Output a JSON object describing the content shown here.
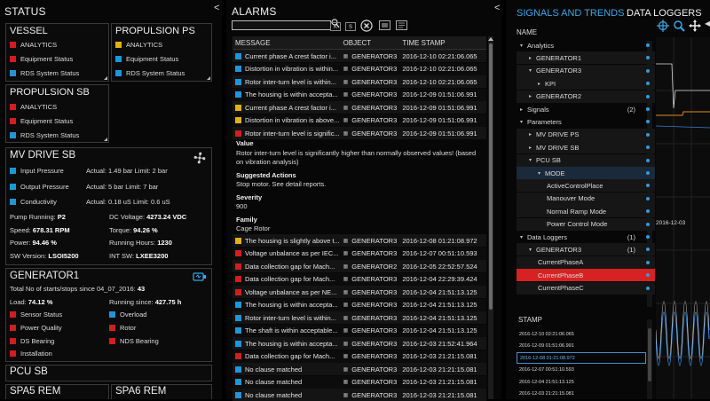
{
  "status": {
    "header": "STATUS",
    "collapse": "<",
    "vessel": {
      "title": "VESSEL",
      "items": [
        "ANALYTICS",
        "Equipment Status",
        "RDS System Status"
      ]
    },
    "propulsion_ps": {
      "title": "PROPULSION PS",
      "items": [
        "ANALYTICS",
        "Equipment Status",
        "RDS System Status"
      ]
    },
    "propulsion_sb": {
      "title": "PROPULSION SB",
      "items": [
        "ANALYTICS",
        "Equipment Status",
        "RDS System Status"
      ]
    },
    "mv_drive_sb": {
      "title": "MV DRIVE SB",
      "metrics": [
        {
          "label": "Input Pressure",
          "value": "Actual: 1.49 bar Limit: 2 bar"
        },
        {
          "label": "Output Pressure",
          "value": "Actual: 5 bar Limit: 7 bar"
        },
        {
          "label": "Conductivity",
          "value": "Actual: 0.18 uS Limit: 0.6 uS"
        }
      ],
      "kv": [
        {
          "k": "Pump Running:",
          "v": "P2"
        },
        {
          "k": "DC Voltage:",
          "v": "4273.24 VDC"
        },
        {
          "k": "Speed:",
          "v": "678.31 RPM"
        },
        {
          "k": "Torque:",
          "v": "94.26 %"
        },
        {
          "k": "Power:",
          "v": "94.46 %"
        },
        {
          "k": "Running Hours:",
          "v": "1230"
        },
        {
          "k": "SW Version:",
          "v": "LSOI5200"
        },
        {
          "k": "INT SW:",
          "v": "LXEE3200"
        }
      ]
    },
    "generator1": {
      "title": "GENERATOR1",
      "starts_label": "Total No of starts/stops since 04_07_2016:",
      "starts_value": "43",
      "load_label": "Load:",
      "load_value": "74.12 %",
      "running_label": "Running since:",
      "running_value": "427.75 h",
      "items_left": [
        "Sensor Status",
        "Power Quality",
        "DS Bearing",
        "Installation"
      ],
      "items_right": [
        "Overload",
        "Rotor",
        "NDS Bearing"
      ]
    },
    "pcu_sb": {
      "title": "PCU SB"
    },
    "spa5": {
      "title": "SPA5 REM"
    },
    "spa6": {
      "title": "SPA6 REM"
    }
  },
  "alarms": {
    "header": "ALARMS",
    "collapse": "<",
    "search_value": "",
    "toolbar": [
      "K",
      "S",
      "",
      "",
      ""
    ],
    "columns": [
      "MESSAGE",
      "OBJECT",
      "TIME STAMP"
    ],
    "rows_top": [
      {
        "color": "blue",
        "msg": "Current phase A crest factor i...",
        "obj": "GENERATOR3",
        "ts": "2016-12-10 02:21:06.065"
      },
      {
        "color": "blue",
        "msg": "Distortion in vibration is within...",
        "obj": "GENERATOR3",
        "ts": "2016-12-10 02:21:06.065"
      },
      {
        "color": "blue",
        "msg": "Rotor inter-turn level is within...",
        "obj": "GENERATOR3",
        "ts": "2016-12-10 02:21:06.065"
      },
      {
        "color": "blue",
        "msg": "The housing is within accepta...",
        "obj": "GENERATOR3",
        "ts": "2016-12-09 01:51:06.991"
      },
      {
        "color": "yel",
        "msg": "Current phase A crest factor i...",
        "obj": "GENERATOR3",
        "ts": "2016-12-09 01:51:06.991"
      },
      {
        "color": "yel",
        "msg": "Distortion in vibration is above...",
        "obj": "GENERATOR3",
        "ts": "2016-12-09 01:51:06.991"
      },
      {
        "color": "red",
        "msg": "Rotor inter-turn level is signific...",
        "obj": "GENERATOR3",
        "ts": "2016-12-09 01:51:06.991"
      }
    ],
    "detail": {
      "value_label": "Value",
      "value_text": "Rotor inter-turn level is significantly higher than normally observed values! (based on vibration analysis)",
      "actions_label": "Suggested Actions",
      "actions_text": "Stop motor. See detail reports.",
      "severity_label": "Severity",
      "severity_value": "900",
      "family_label": "Family",
      "family_value": "Cage Rotor"
    },
    "rows_bottom": [
      {
        "color": "yel",
        "msg": "The housing is slightly above t...",
        "obj": "GENERATOR3",
        "ts": "2016-12-08 01:21:08.972"
      },
      {
        "color": "red",
        "msg": "Voltage unbalance as per IEC...",
        "obj": "GENERATOR3",
        "ts": "2016-12-07 00:51:10.593"
      },
      {
        "color": "red",
        "msg": "Data collection gap for Mach...",
        "obj": "GENERATOR2",
        "ts": "2016-12-05 22:52:57.524"
      },
      {
        "color": "red",
        "msg": "Data collection gap for Mach...",
        "obj": "GENERATOR3",
        "ts": "2016-12-04 22:29:39.424"
      },
      {
        "color": "red",
        "msg": "Voltage unbalance as per NE...",
        "obj": "GENERATOR3",
        "ts": "2016-12-04 21:51:13.125"
      },
      {
        "color": "blue",
        "msg": "The housing is within accepta...",
        "obj": "GENERATOR3",
        "ts": "2016-12-04 21:51:13.125"
      },
      {
        "color": "blue",
        "msg": "Rotor inter-turn level is within...",
        "obj": "GENERATOR3",
        "ts": "2016-12-04 21:51:13.125"
      },
      {
        "color": "blue",
        "msg": "The shaft is within acceptable...",
        "obj": "GENERATOR3",
        "ts": "2016-12-04 21:51:13.125"
      },
      {
        "color": "blue",
        "msg": "The housing is within accepta...",
        "obj": "GENERATOR3",
        "ts": "2016-12-03 21:52:41.964"
      },
      {
        "color": "red",
        "msg": "Data collection gap for Mach...",
        "obj": "GENERATOR3",
        "ts": "2016-12-03 21:21:15.081"
      },
      {
        "color": "blue",
        "msg": "No clause matched",
        "obj": "GENERATOR3",
        "ts": "2016-12-03 21:21:15.081"
      },
      {
        "color": "blue",
        "msg": "No clause matched",
        "obj": "GENERATOR3",
        "ts": "2016-12-03 21:21:15.081"
      },
      {
        "color": "blue",
        "msg": "No clause matched",
        "obj": "GENERATOR3",
        "ts": "2016-12-03 21:21:15.081"
      }
    ]
  },
  "signals": {
    "tab_active": "SIGNALS AND TRENDS",
    "tab_other": "DATA LOGGERS",
    "name_header": "NAME",
    "tree": [
      {
        "label": "Analytics",
        "indent": 0,
        "arrow": "▾",
        "count": "",
        "style": "plain"
      },
      {
        "label": "GENERATOR1",
        "indent": 1,
        "arrow": "▸",
        "count": "",
        "style": "plain"
      },
      {
        "label": "GENERATOR3",
        "indent": 1,
        "arrow": "▾",
        "count": "",
        "style": "plain"
      },
      {
        "label": "KPI",
        "indent": 2,
        "arrow": "▸",
        "count": "",
        "style": "plain"
      },
      {
        "label": "GENERATOR2",
        "indent": 1,
        "arrow": "▸",
        "count": "",
        "style": "plain"
      },
      {
        "label": "Signals",
        "indent": 0,
        "arrow": "▸",
        "count": "(2)",
        "style": "plain"
      },
      {
        "label": "Parameters",
        "indent": 0,
        "arrow": "▾",
        "count": "",
        "style": "plain"
      },
      {
        "label": "MV DRIVE PS",
        "indent": 1,
        "arrow": "▸",
        "count": "",
        "style": "plain"
      },
      {
        "label": "MV DRIVE SB",
        "indent": 1,
        "arrow": "▸",
        "count": "",
        "style": "plain"
      },
      {
        "label": "PCU SB",
        "indent": 1,
        "arrow": "▾",
        "count": "",
        "style": "plain"
      },
      {
        "label": "MODE",
        "indent": 2,
        "arrow": "▾",
        "count": "",
        "style": "mode"
      },
      {
        "label": "ActiveControlPlace",
        "indent": 3,
        "arrow": "",
        "count": "",
        "style": "plain"
      },
      {
        "label": "Manouver Mode",
        "indent": 3,
        "arrow": "",
        "count": "",
        "style": "plain"
      },
      {
        "label": "Normal Ramp Mode",
        "indent": 3,
        "arrow": "",
        "count": "",
        "style": "plain"
      },
      {
        "label": "Power Control Mode",
        "indent": 3,
        "arrow": "",
        "count": "",
        "style": "plain"
      },
      {
        "label": "Data Loggers",
        "indent": 0,
        "arrow": "▾",
        "count": "(1)",
        "style": "plain"
      },
      {
        "label": "GENERATOR3",
        "indent": 1,
        "arrow": "▾",
        "count": "(1)",
        "style": "plain"
      },
      {
        "label": "CurrentPhaseA",
        "indent": 2,
        "arrow": "",
        "count": "",
        "style": "plain"
      },
      {
        "label": "CurrentPhaseB",
        "indent": 2,
        "arrow": "",
        "count": "",
        "style": "selected"
      },
      {
        "label": "CurrentPhaseC",
        "indent": 2,
        "arrow": "",
        "count": "",
        "style": "plain"
      }
    ],
    "stamp_header": "STAMP",
    "stamps": [
      {
        "text": "2016-12-10 02:21:06.065",
        "selected": false
      },
      {
        "text": "2016-12-09 01:51:06.991",
        "selected": false
      },
      {
        "text": "2016-12-08 01:21:08.972",
        "selected": true
      },
      {
        "text": "2016-12-07 00:51:10.593",
        "selected": false
      },
      {
        "text": "2016-12-04 21:51:13.125",
        "selected": false
      },
      {
        "text": "2016-12-03 21:21:15.081",
        "selected": false
      }
    ],
    "chart_date_label": "2016-12-03",
    "colors": {
      "accent": "#2b9be6",
      "selected": "#d62222",
      "red": "#d21e1e",
      "blue": "#1e96dc",
      "yellow": "#e0b018"
    }
  }
}
